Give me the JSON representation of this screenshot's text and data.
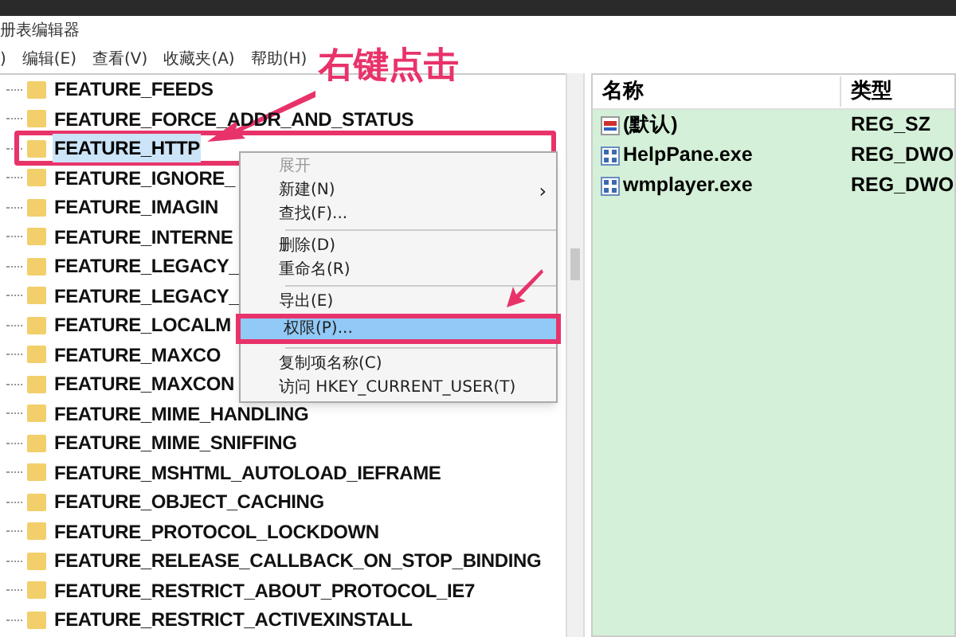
{
  "window": {
    "title": "册表编辑器"
  },
  "menu_bar": [
    ")",
    "编辑(E)",
    "查看(V)",
    "收藏夹(A)",
    "帮助(H)"
  ],
  "tree": [
    {
      "label": "FEATURE_FEEDS",
      "selected": false
    },
    {
      "label": "FEATURE_FORCE_ADDR_AND_STATUS",
      "selected": false
    },
    {
      "label": "FEATURE_HTTP",
      "selected": true,
      "outlined": true
    },
    {
      "label": "FEATURE_IGNORE_",
      "selected": false
    },
    {
      "label": "FEATURE_IMAGIN",
      "selected": false
    },
    {
      "label": "FEATURE_INTERNE",
      "selected": false
    },
    {
      "label": "FEATURE_LEGACY_",
      "selected": false
    },
    {
      "label": "FEATURE_LEGACY_",
      "selected": false
    },
    {
      "label": "FEATURE_LOCALM",
      "selected": false
    },
    {
      "label": "FEATURE_MAXCO",
      "selected": false
    },
    {
      "label": "FEATURE_MAXCON",
      "selected": false
    },
    {
      "label": "FEATURE_MIME_HANDLING",
      "selected": false
    },
    {
      "label": "FEATURE_MIME_SNIFFING",
      "selected": false
    },
    {
      "label": "FEATURE_MSHTML_AUTOLOAD_IEFRAME",
      "selected": false
    },
    {
      "label": "FEATURE_OBJECT_CACHING",
      "selected": false
    },
    {
      "label": "FEATURE_PROTOCOL_LOCKDOWN",
      "selected": false
    },
    {
      "label": "FEATURE_RELEASE_CALLBACK_ON_STOP_BINDING",
      "selected": false
    },
    {
      "label": "FEATURE_RESTRICT_ABOUT_PROTOCOL_IE7",
      "selected": false
    },
    {
      "label": "FEATURE_RESTRICT_ACTIVEXINSTALL",
      "selected": false
    }
  ],
  "context_menu": [
    {
      "kind": "item",
      "label": "展开",
      "disabled": true,
      "selected": false
    },
    {
      "kind": "submenu",
      "label": "新建(N)",
      "arrow": "›",
      "disabled": false,
      "selected": false
    },
    {
      "kind": "item",
      "label": "查找(F)...",
      "disabled": false,
      "selected": false
    },
    {
      "kind": "separator"
    },
    {
      "kind": "item",
      "label": "删除(D)",
      "disabled": false,
      "selected": false
    },
    {
      "kind": "item",
      "label": "重命名(R)",
      "disabled": false,
      "selected": false
    },
    {
      "kind": "separator"
    },
    {
      "kind": "item",
      "label": "导出(E)",
      "disabled": false,
      "selected": false
    },
    {
      "kind": "item",
      "label": "权限(P)...",
      "disabled": false,
      "selected": true,
      "outlined": true
    },
    {
      "kind": "separator"
    },
    {
      "kind": "item",
      "label": "复制项名称(C)",
      "disabled": false,
      "selected": false
    },
    {
      "kind": "item",
      "label": "访问 HKEY_CURRENT_USER(T)",
      "disabled": false,
      "selected": false
    }
  ],
  "values": {
    "columns": [
      "名称",
      "类型"
    ],
    "rows": [
      {
        "kind": "string",
        "name": "(默认)",
        "type": "REG_SZ"
      },
      {
        "kind": "binary",
        "name": "HelpPane.exe",
        "type": "REG_DWO"
      },
      {
        "kind": "binary",
        "name": "wmplayer.exe",
        "type": "REG_DWO"
      }
    ]
  },
  "annotation": {
    "text": "右键点击"
  }
}
